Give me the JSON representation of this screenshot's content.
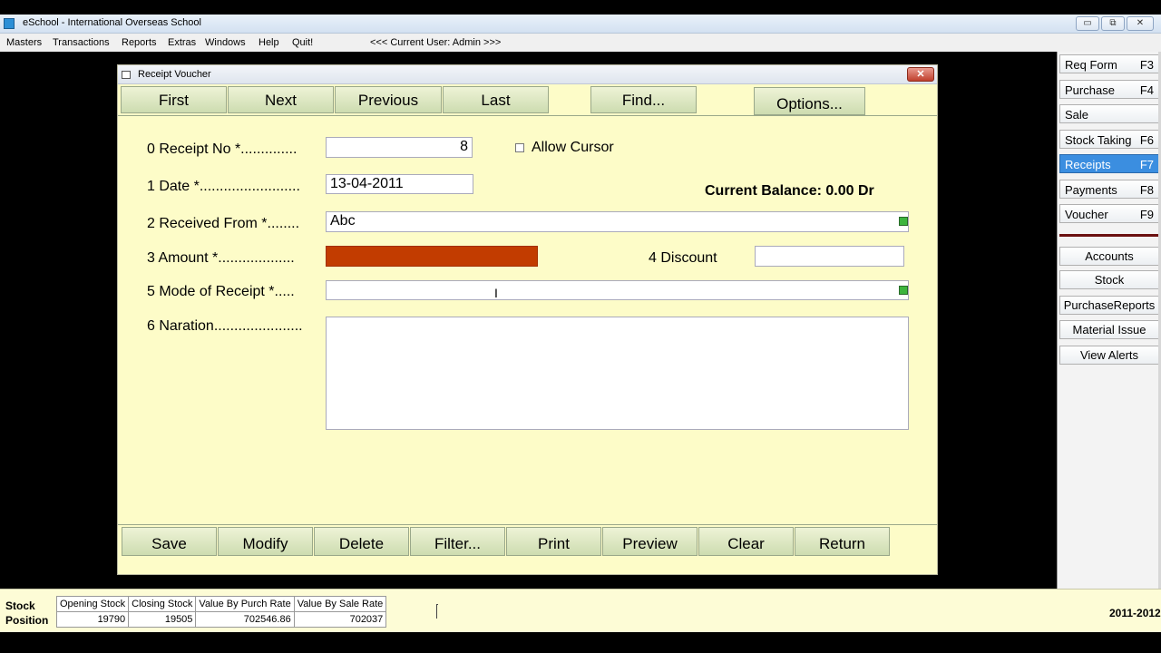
{
  "app": {
    "title": "eSchool - International Overseas School",
    "window_buttons": {
      "minimize": "▭",
      "restore": "⧉",
      "close": "✕"
    }
  },
  "menu": {
    "items": [
      "Masters",
      "Transactions",
      "Reports",
      "Extras",
      "Windows",
      "Help",
      "Quit!"
    ],
    "user_info": "<<<  Current User: Admin >>>"
  },
  "form": {
    "title": "Receipt Voucher",
    "close": "✕",
    "nav": {
      "first": "First",
      "next": "Next",
      "previous": "Previous",
      "last": "Last",
      "find": "Find...",
      "options": "Options..."
    },
    "fields": {
      "receipt_no_label": "0 Receipt No *..............",
      "receipt_no_value": "8",
      "allow_cursor_label": "Allow Cursor",
      "date_label": "1 Date *.........................",
      "date_value": "13-04-2011",
      "current_balance": "Current Balance: 0.00 Dr",
      "received_from_label": "2 Received From *........",
      "received_from_value": "Abc",
      "amount_label": "3 Amount *...................",
      "amount_value": "",
      "discount_label": "4 Discount",
      "discount_value": "",
      "mode_label": "5 Mode of Receipt *.....",
      "mode_value": "",
      "naration_label": "6 Naration......................",
      "naration_value": ""
    },
    "actions": {
      "save": "Save",
      "modify": "Modify",
      "delete": "Delete",
      "filter": "Filter...",
      "print": "Print",
      "preview": "Preview",
      "clear": "Clear",
      "return": "Return"
    },
    "amount_color": "#c23c00"
  },
  "sidebar": {
    "quick": [
      {
        "label": "Req Form",
        "key": "F3"
      },
      {
        "label": "Purchase",
        "key": "F4"
      },
      {
        "label": "Sale",
        "key": ""
      },
      {
        "label": "Stock Taking",
        "key": "F6"
      },
      {
        "label": "Receipts",
        "key": "F7"
      },
      {
        "label": "Payments",
        "key": "F8"
      },
      {
        "label": "Voucher",
        "key": "F9"
      }
    ],
    "modules": [
      "Accounts",
      "Stock",
      "PurchaseReports",
      "Material Issue",
      "View Alerts"
    ],
    "active_color": "#3b8ee0"
  },
  "status": {
    "stock_position": "Stock Position",
    "headers": [
      "Opening Stock",
      "Closing Stock",
      "Value By Purch Rate",
      "Value By Sale Rate"
    ],
    "values": [
      "19790",
      "19505",
      "702546.86",
      "702037"
    ],
    "year": "2011-2012"
  }
}
